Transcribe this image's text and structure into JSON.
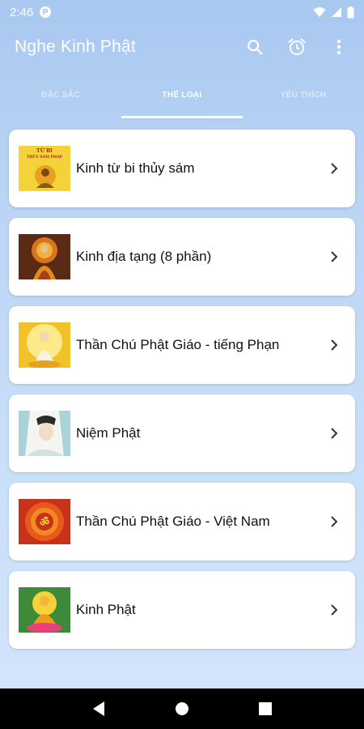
{
  "status_bar": {
    "time": "2:46",
    "app_icon_glyph": "P"
  },
  "app_bar": {
    "title": "Nghe Kinh Phật"
  },
  "tabs": [
    {
      "label": "ĐẶC SẮC",
      "active": false
    },
    {
      "label": "THỂ LOẠI",
      "active": true
    },
    {
      "label": "YÊU THÍCH",
      "active": false
    }
  ],
  "categories": [
    {
      "title": "Kinh từ bi thủy sám",
      "thumb_text_1": "TỪ BI",
      "thumb_text_2": "THỦY SÁM PHÁP"
    },
    {
      "title": "Kinh địa tạng (8 phần)"
    },
    {
      "title": "Thần Chú Phật Giáo - tiếng Phạn"
    },
    {
      "title": "Niệm Phật"
    },
    {
      "title": "Thần Chú Phật Giáo - Việt Nam"
    },
    {
      "title": "Kinh Phật"
    }
  ],
  "colors": {
    "accent": "#ffffff",
    "background_top": "#a9c8f0",
    "background_bottom": "#d3e5fa"
  },
  "icons": [
    "search-icon",
    "alarm-icon",
    "more-vert-icon",
    "chevron-right-icon",
    "back-icon",
    "home-icon",
    "recents-icon"
  ]
}
